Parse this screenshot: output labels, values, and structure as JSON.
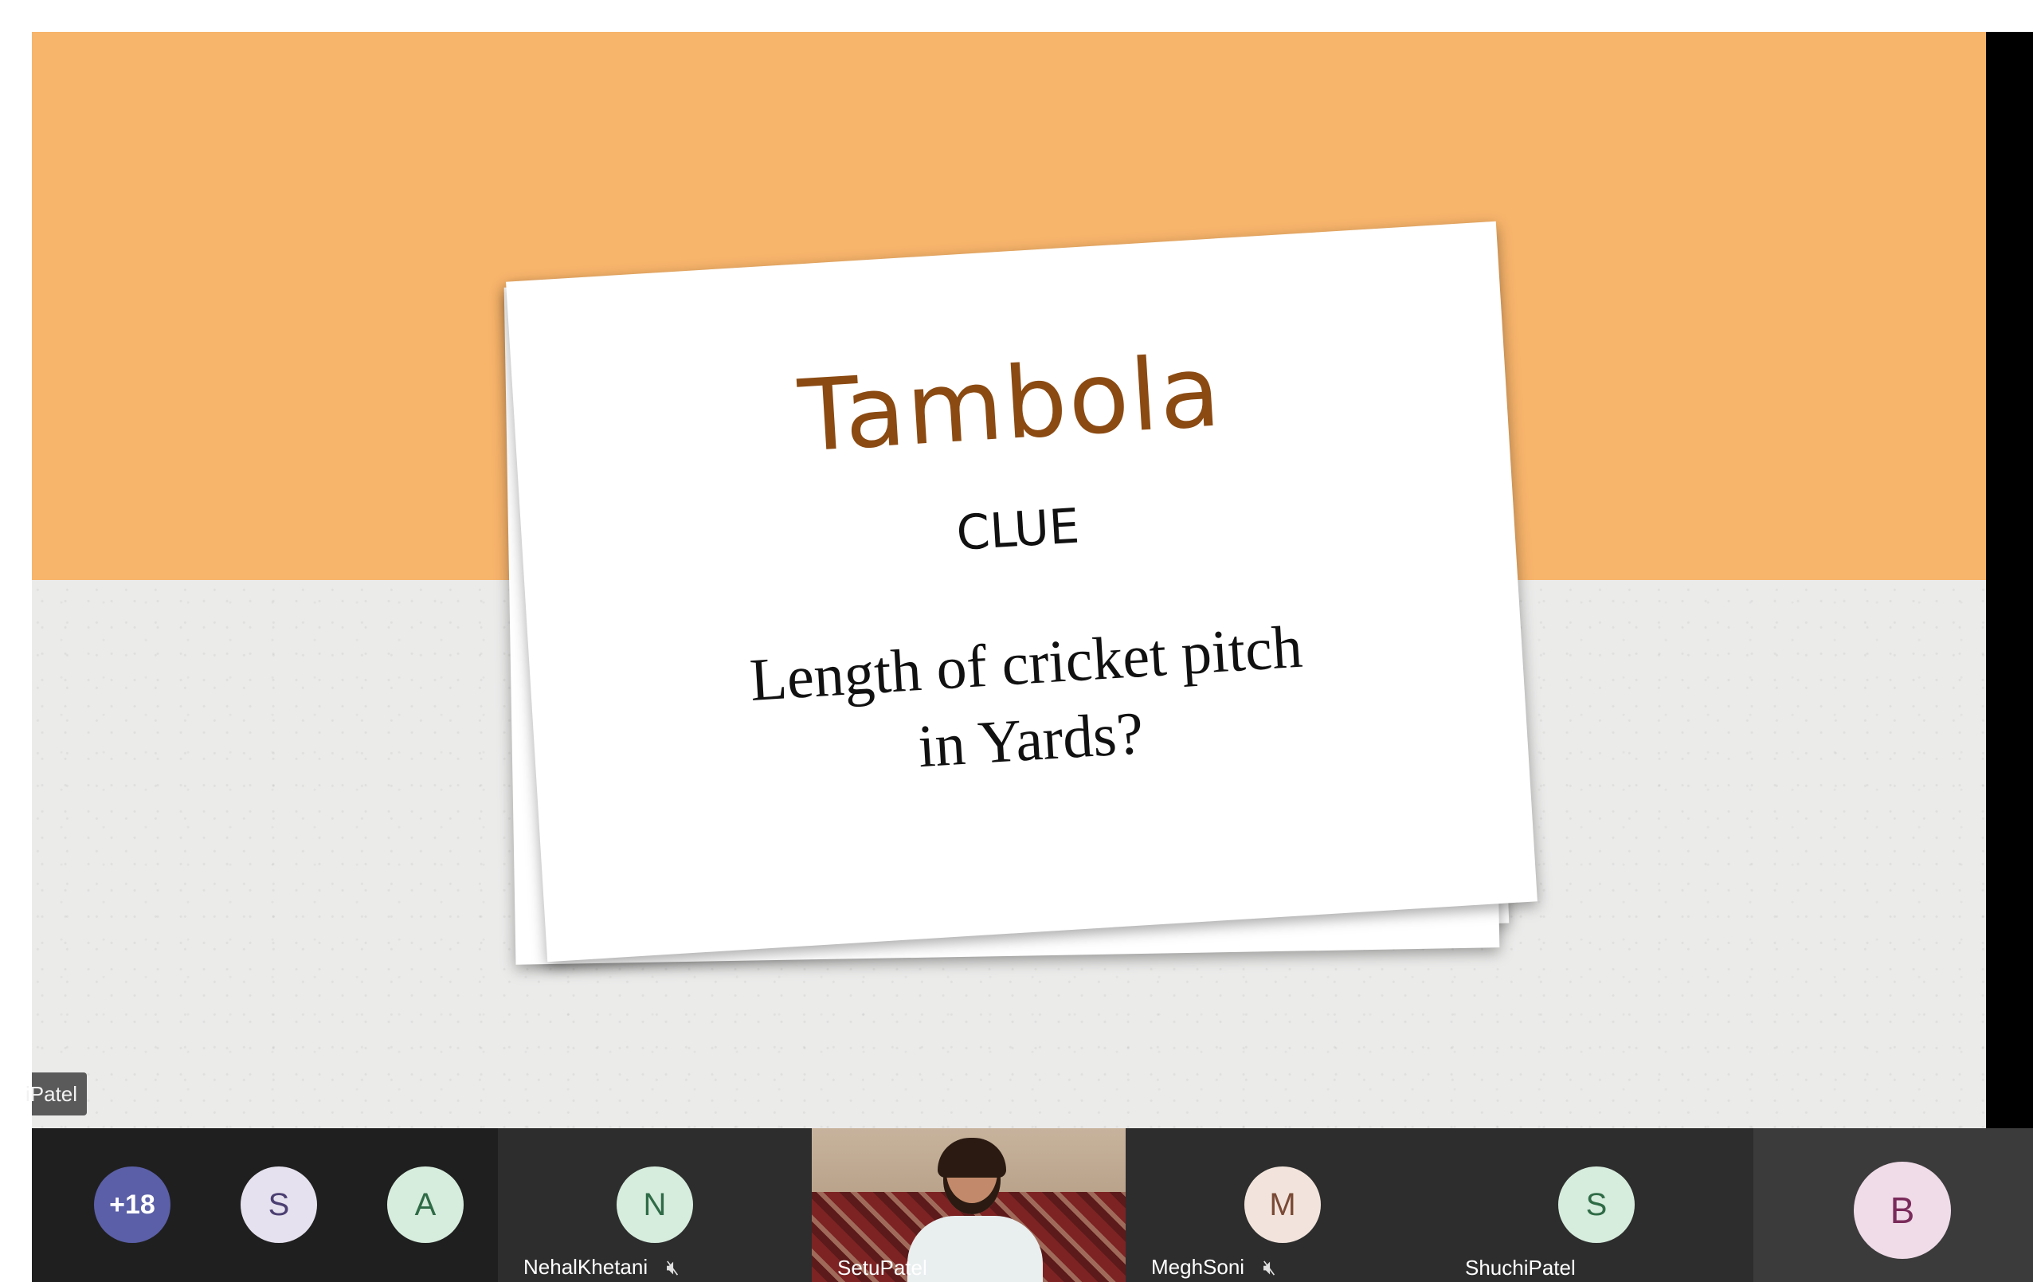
{
  "slide": {
    "title": "Tambola",
    "clue_label": "CLUE",
    "question_line1": "Length of cricket pitch",
    "question_line2": "in Yards?"
  },
  "presenter_tag": "iPatel",
  "participants": {
    "overflow_count": "+18",
    "group_avatars": [
      "S",
      "A"
    ],
    "tiles": [
      {
        "initial": "N",
        "name": "NehalKhetani",
        "muted": true
      },
      {
        "initial": "",
        "name": "SetuPatel",
        "muted": false,
        "video": true
      },
      {
        "initial": "M",
        "name": "MeghSoni",
        "muted": true
      },
      {
        "initial": "S",
        "name": "ShuchiPatel",
        "muted": false
      },
      {
        "initial": "B",
        "name": "",
        "muted": false
      }
    ]
  },
  "icons": {
    "mic_off": "mic-off-icon"
  },
  "colors": {
    "slide_top": "#f7b46b",
    "title_brown": "#8b4a12",
    "overflow_badge": "#6264a7"
  }
}
